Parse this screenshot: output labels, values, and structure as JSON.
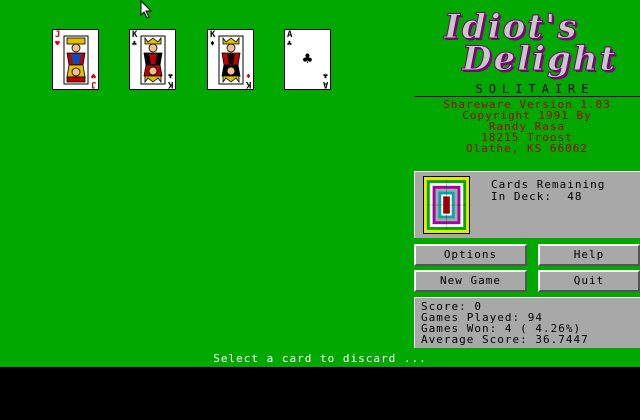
{
  "cards": [
    {
      "rank": "J",
      "suit_symbol": "♥",
      "color": "red"
    },
    {
      "rank": "K",
      "suit_symbol": "♣",
      "color": "black"
    },
    {
      "rank": "K",
      "suit_symbol": "♦",
      "color": "red"
    },
    {
      "rank": "A",
      "suit_symbol": "♣",
      "color": "black"
    }
  ],
  "title": {
    "line1": "Idiot's",
    "line2": "Delight",
    "subtitle": "SOLITAIRE"
  },
  "credits": [
    "Shareware Version 1.03",
    "Copyright 1991 By",
    "Randy Rasa",
    "18215 Troost",
    "Olathe, KS 66062"
  ],
  "deck": {
    "label_line1": "Cards Remaining",
    "label_line2": "In Deck:  48"
  },
  "buttons": {
    "options": "Options",
    "help": "Help",
    "new_game": "New Game",
    "quit": "Quit"
  },
  "stats": {
    "score": "Score: 0",
    "games_played": "Games Played: 94",
    "games_won": "Games Won: 4 ( 4.26%)",
    "average_score": "Average Score: 36.7447"
  },
  "status": "Select a card to discard ...",
  "colors": {
    "felt": "#00a800",
    "panel": "#a8a8a8",
    "credits_text": "#a80000"
  }
}
